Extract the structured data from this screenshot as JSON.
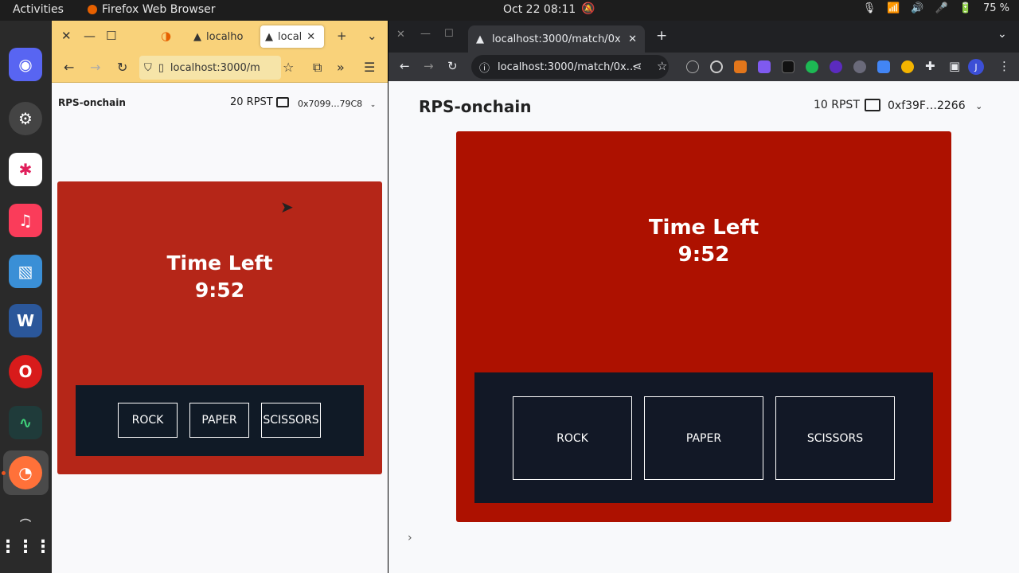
{
  "system": {
    "activities": "Activities",
    "app_name": "Firefox Web Browser",
    "clock": "Oct 22  08:11",
    "battery": "75 %"
  },
  "firefox": {
    "tabs": [
      {
        "label": "localho"
      },
      {
        "label": "local"
      }
    ],
    "url": "localhost:3000/m",
    "app_title": "RPS-onchain",
    "balance": "20 RPST",
    "address": "0x7099…79C8",
    "time_left_label": "Time Left",
    "time_left_value": "9:52",
    "moves": [
      "ROCK",
      "PAPER",
      "SCISSORS"
    ]
  },
  "chrome": {
    "tab_label": "localhost:3000/match/0x",
    "url": "localhost:3000/match/0x…",
    "app_title": "RPS-onchain",
    "balance": "10 RPST",
    "address": "0xf39F…2266",
    "time_left_label": "Time Left",
    "time_left_value": "9:52",
    "moves": [
      "ROCK",
      "PAPER",
      "SCISSORS"
    ]
  },
  "colors": {
    "card_red_small": "#b52618",
    "card_red_large": "#ad1100",
    "panel_dark": "#121826",
    "firefox_chrome_bar": "#f9d27a"
  }
}
